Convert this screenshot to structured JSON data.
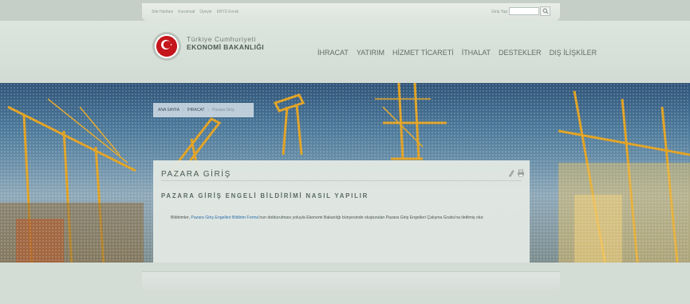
{
  "top_links": [
    "Site Haritası",
    "Kurumsal",
    "Üyeyle",
    "EBYS Evrak"
  ],
  "search": {
    "label": "Giriş Yap",
    "placeholder": "",
    "icon": "search-icon"
  },
  "brand": {
    "line1": "Türkiye Cumhuriyeti",
    "line2": "EKONOMİ BAKANLIĞI",
    "logo_color": "#c4161c"
  },
  "nav": [
    "İHRACAT",
    "YATIRIM",
    "HİZMET TİCARETİ",
    "İTHALAT",
    "DESTEKLER",
    "DIŞ İLİŞKİLER"
  ],
  "breadcrumb": [
    "ANA SAYFA",
    "İHRACAT",
    "Pazara Giriş"
  ],
  "panel": {
    "title": "PAZARA GİRİŞ",
    "subtitle": "PAZARA GİRİŞ ENGELİ BİLDİRİMİ NASIL YAPILIR",
    "text_before": "Bildirimler, ",
    "link": "Pazara Giriş Engelleri Bildirim Formu",
    "text_after": "'nun doldurulması yoluyla Ekonomi Bakanlığı bünyesinde oluşturulan Pazara Giriş Engelleri Çalışma Grubu'na iletilmiş olur.",
    "icons": [
      "paperclip-icon",
      "print-icon"
    ]
  },
  "colors": {
    "accent_link": "#2f6fa8",
    "page_bg": "#d4dcd6",
    "crane": "#e0a020"
  }
}
